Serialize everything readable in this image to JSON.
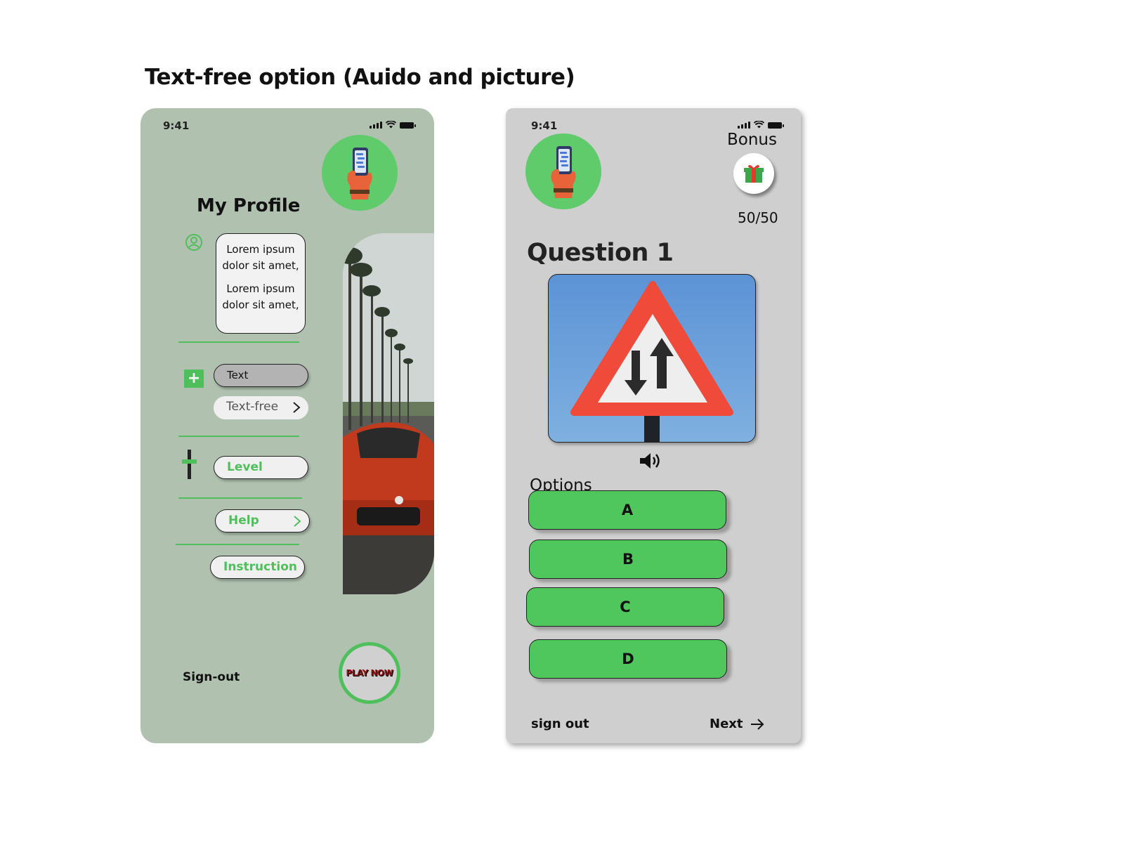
{
  "page": {
    "title": "Text-free option (Auido and picture)"
  },
  "profile_screen": {
    "status_time": "9:41",
    "title": "My Profile",
    "bio_lines": [
      "Lorem ipsum dolor sit amet,",
      "Lorem ipsum dolor sit amet,"
    ],
    "mode_text_label": "Text",
    "mode_textfree_label": "Text-free",
    "level_label": "Level",
    "help_label": "Help",
    "instruction_label": "Instruction",
    "signout_label": "Sign-out",
    "play_label": "PLAY NOW"
  },
  "quiz_screen": {
    "status_time": "9:41",
    "bonus_label": "Bonus",
    "score": "50/50",
    "question_title": "Question 1",
    "options_label": "Options",
    "options": [
      "A",
      "B",
      "C",
      "D"
    ],
    "signout_label": "sign out",
    "next_label": "Next"
  },
  "colors": {
    "accent_green": "#4fc75c",
    "profile_bg": "#b0c1b0",
    "quiz_bg": "#cfcfcf"
  },
  "icons": [
    "user-icon",
    "plus-icon",
    "slider-icon",
    "chevron-right-icon",
    "gift-icon",
    "speaker-icon",
    "arrow-right-icon",
    "signal-icon",
    "wifi-icon",
    "battery-icon"
  ]
}
